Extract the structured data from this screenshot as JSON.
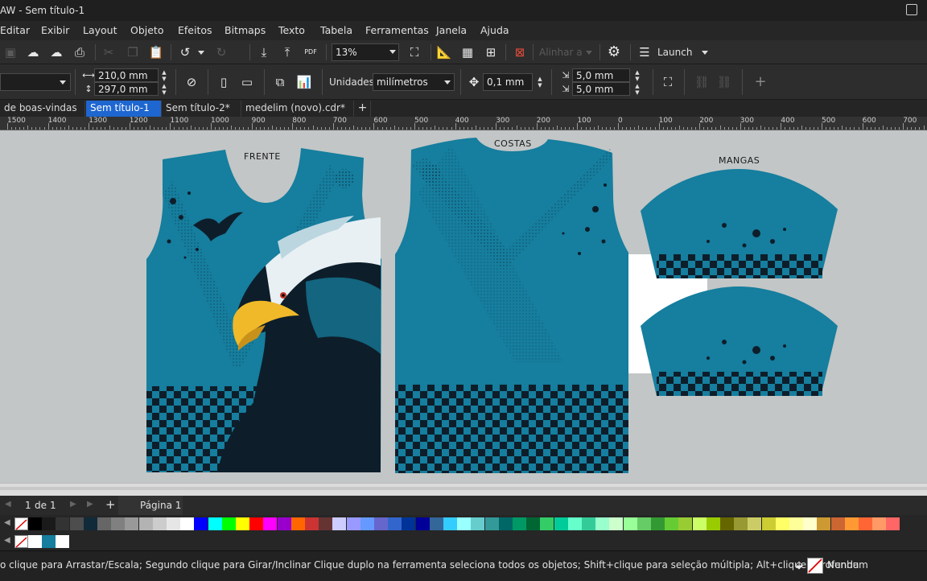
{
  "window": {
    "title": "AW - Sem título-1"
  },
  "menu": [
    "Editar",
    "Exibir",
    "Layout",
    "Objeto",
    "Efeitos",
    "Bitmaps",
    "Texto",
    "Tabela",
    "Ferramentas",
    "Janela",
    "Ajuda"
  ],
  "toolbar": {
    "zoom": "13%",
    "align_label": "Alinhar a",
    "launch_label": "Launch"
  },
  "property_bar": {
    "width": "210,0 mm",
    "height": "297,0 mm",
    "units_label": "Unidades:",
    "units_value": "milímetros",
    "nudge": "0,1 mm",
    "dup_x": "5,0 mm",
    "dup_y": "5,0 mm"
  },
  "tabs": [
    {
      "label": "de boas-vindas",
      "active": false
    },
    {
      "label": "Sem título-1",
      "active": true
    },
    {
      "label": "Sem título-2*",
      "active": false
    },
    {
      "label": "medelim (novo).cdr*",
      "active": false
    }
  ],
  "ruler_labels": [
    "1500",
    "1400",
    "1300",
    "1200",
    "1100",
    "1000",
    "900",
    "800",
    "700",
    "600",
    "500",
    "400",
    "300",
    "200",
    "100",
    "0",
    "100",
    "200",
    "300",
    "400",
    "500",
    "600",
    "700"
  ],
  "canvas": {
    "front_label": "FRENTE",
    "back_label": "COSTAS",
    "sleeves_label": "MANGAS",
    "jersey_color": "#167e9e"
  },
  "page_nav": {
    "current": "1",
    "of_label": "de",
    "total": "1",
    "add": "+",
    "page_tab": "Página 1"
  },
  "palette": [
    "#000000",
    "#1a1a1a",
    "#333333",
    "#4d4d4d",
    "#102a3a",
    "#666666",
    "#808080",
    "#999999",
    "#b3b3b3",
    "#cccccc",
    "#e6e6e6",
    "#ffffff",
    "#0000ff",
    "#00ffff",
    "#00ff00",
    "#ffff00",
    "#ff0000",
    "#ff00ff",
    "#9900cc",
    "#ff6600",
    "#cc3333",
    "#663333",
    "#ccccff",
    "#9999ff",
    "#6699ff",
    "#6666cc",
    "#3366cc",
    "#003399",
    "#000099",
    "#336699",
    "#33ccff",
    "#99ffff",
    "#66cccc",
    "#339999",
    "#006666",
    "#009966",
    "#006633",
    "#33cc66",
    "#00cc99",
    "#66ffcc",
    "#33cc99",
    "#99ffcc",
    "#ccffcc",
    "#99ff99",
    "#66cc66",
    "#339933",
    "#66cc33",
    "#99cc33",
    "#ccff66",
    "#99cc00",
    "#666600",
    "#999933",
    "#cccc66",
    "#cccc33",
    "#ffff66",
    "#ffff99",
    "#ffffcc",
    "#cc9933",
    "#cc6633",
    "#ff9933",
    "#ff6633",
    "#ff9966",
    "#ff6666"
  ],
  "doc_palette": [
    "#167e9e",
    "#ffffff"
  ],
  "status": {
    "message": "o clique para Arrastar/Escala; Segundo clique para Girar/Inclinar Clique duplo na ferramenta seleciona todos os objetos; Shift+clique para seleção múltipla; Alt+clique aprofunda",
    "fill_label": "Nenhum"
  }
}
